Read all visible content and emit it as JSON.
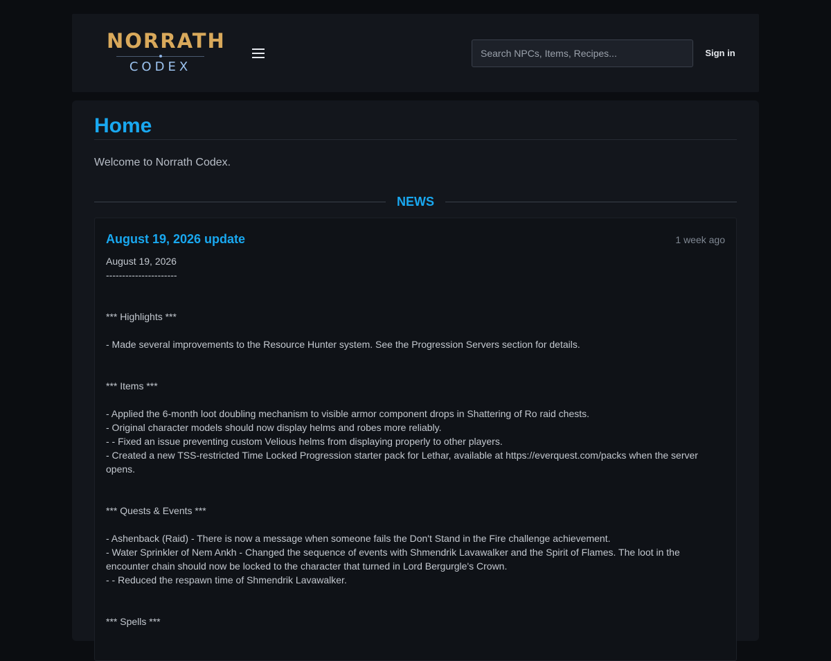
{
  "header": {
    "logo_top": "NORRATH",
    "logo_bottom": "CODEX",
    "search_placeholder": "Search NPCs, Items, Recipes...",
    "signin_label": "Sign in"
  },
  "main": {
    "title": "Home",
    "welcome": "Welcome to Norrath Codex.",
    "news_heading": "NEWS"
  },
  "news": {
    "title": "August 19, 2026 update",
    "age": "1 week ago",
    "lines": [
      "August 19, 2026",
      "----------------------",
      "",
      "",
      "*** Highlights ***",
      "",
      "- Made several improvements to the Resource Hunter system. See the Progression Servers section for details.",
      "",
      "",
      "*** Items ***",
      "",
      "- Applied the 6-month loot doubling mechanism to visible armor component drops in Shattering of Ro raid chests.",
      "- Original character models should now display helms and robes more reliably.",
      "- - Fixed an issue preventing custom Velious helms from displaying properly to other players.",
      "- Created a new TSS-restricted Time Locked Progression starter pack for Lethar, available at https://everquest.com/packs when the server opens.",
      "",
      "",
      "*** Quests & Events ***",
      "",
      "- Ashenback (Raid) - There is now a message when someone fails the Don't Stand in the Fire challenge achievement.",
      "- Water Sprinkler of Nem Ankh - Changed the sequence of events with Shmendrik Lavawalker and the Spirit of Flames. The loot in the encounter chain should now be locked to the character that turned in Lord Bergurgle's Crown.",
      "- - Reduced the respawn time of Shmendrik Lavawalker.",
      "",
      "",
      "*** Spells ***"
    ]
  },
  "colors": {
    "accent": "#19a8f0",
    "logo_gold": "#d9a95b",
    "logo_blue": "#9cc3ef",
    "background": "#0b0d11",
    "panel": "#13161c"
  },
  "icons": {
    "menu": "hamburger-menu-icon"
  }
}
